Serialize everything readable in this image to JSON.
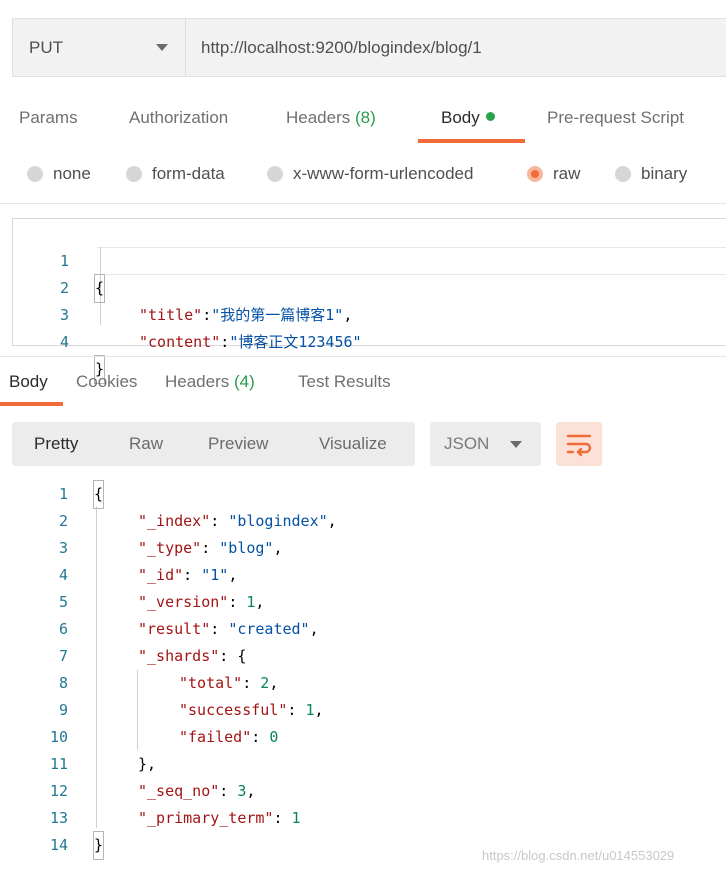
{
  "request": {
    "method": "PUT",
    "url": "http://localhost:9200/blogindex/blog/1"
  },
  "request_tabs": {
    "params": "Params",
    "authorization": "Authorization",
    "headers": "Headers",
    "headers_count": "(8)",
    "body": "Body",
    "prerequest": "Pre-request Script"
  },
  "body_types": {
    "none": "none",
    "form_data": "form-data",
    "urlencoded": "x-www-form-urlencoded",
    "raw": "raw",
    "binary": "binary",
    "selected": "raw"
  },
  "request_body": {
    "line_numbers": [
      "1",
      "2",
      "3",
      "4"
    ],
    "open_brace": "{",
    "close_brace": "}",
    "title_key": "\"title\"",
    "title_value": "\"我的第一篇博客1\"",
    "content_key": "\"content\"",
    "content_value": "\"博客正文123456\""
  },
  "response_tabs": {
    "body": "Body",
    "cookies": "Cookies",
    "headers": "Headers",
    "headers_count": "(4)",
    "test_results": "Test Results"
  },
  "view_modes": {
    "pretty": "Pretty",
    "raw": "Raw",
    "preview": "Preview",
    "visualize": "Visualize",
    "format": "JSON"
  },
  "response_body": {
    "line_numbers": [
      "1",
      "2",
      "3",
      "4",
      "5",
      "6",
      "7",
      "8",
      "9",
      "10",
      "11",
      "12",
      "13",
      "14"
    ],
    "open_brace": "{",
    "close_brace": "}",
    "index_key": "\"_index\"",
    "index_value": "\"blogindex\"",
    "type_key": "\"_type\"",
    "type_value": "\"blog\"",
    "id_key": "\"_id\"",
    "id_value": "\"1\"",
    "version_key": "\"_version\"",
    "version_value": "1",
    "result_key": "\"result\"",
    "result_value": "\"created\"",
    "shards_key": "\"_shards\"",
    "total_key": "\"total\"",
    "total_value": "2",
    "successful_key": "\"successful\"",
    "successful_value": "1",
    "failed_key": "\"failed\"",
    "failed_value": "0",
    "shards_close": "},",
    "seq_no_key": "\"_seq_no\"",
    "seq_no_value": "3",
    "primary_term_key": "\"_primary_term\"",
    "primary_term_value": "1"
  },
  "watermark": "https://blog.csdn.net/u014553029",
  "colors": {
    "accent": "#f26b3a",
    "count_green": "#2a9d4a",
    "json_key": "#a31515",
    "json_string": "#0451a5",
    "json_number": "#098658",
    "line_number": "#237893"
  }
}
